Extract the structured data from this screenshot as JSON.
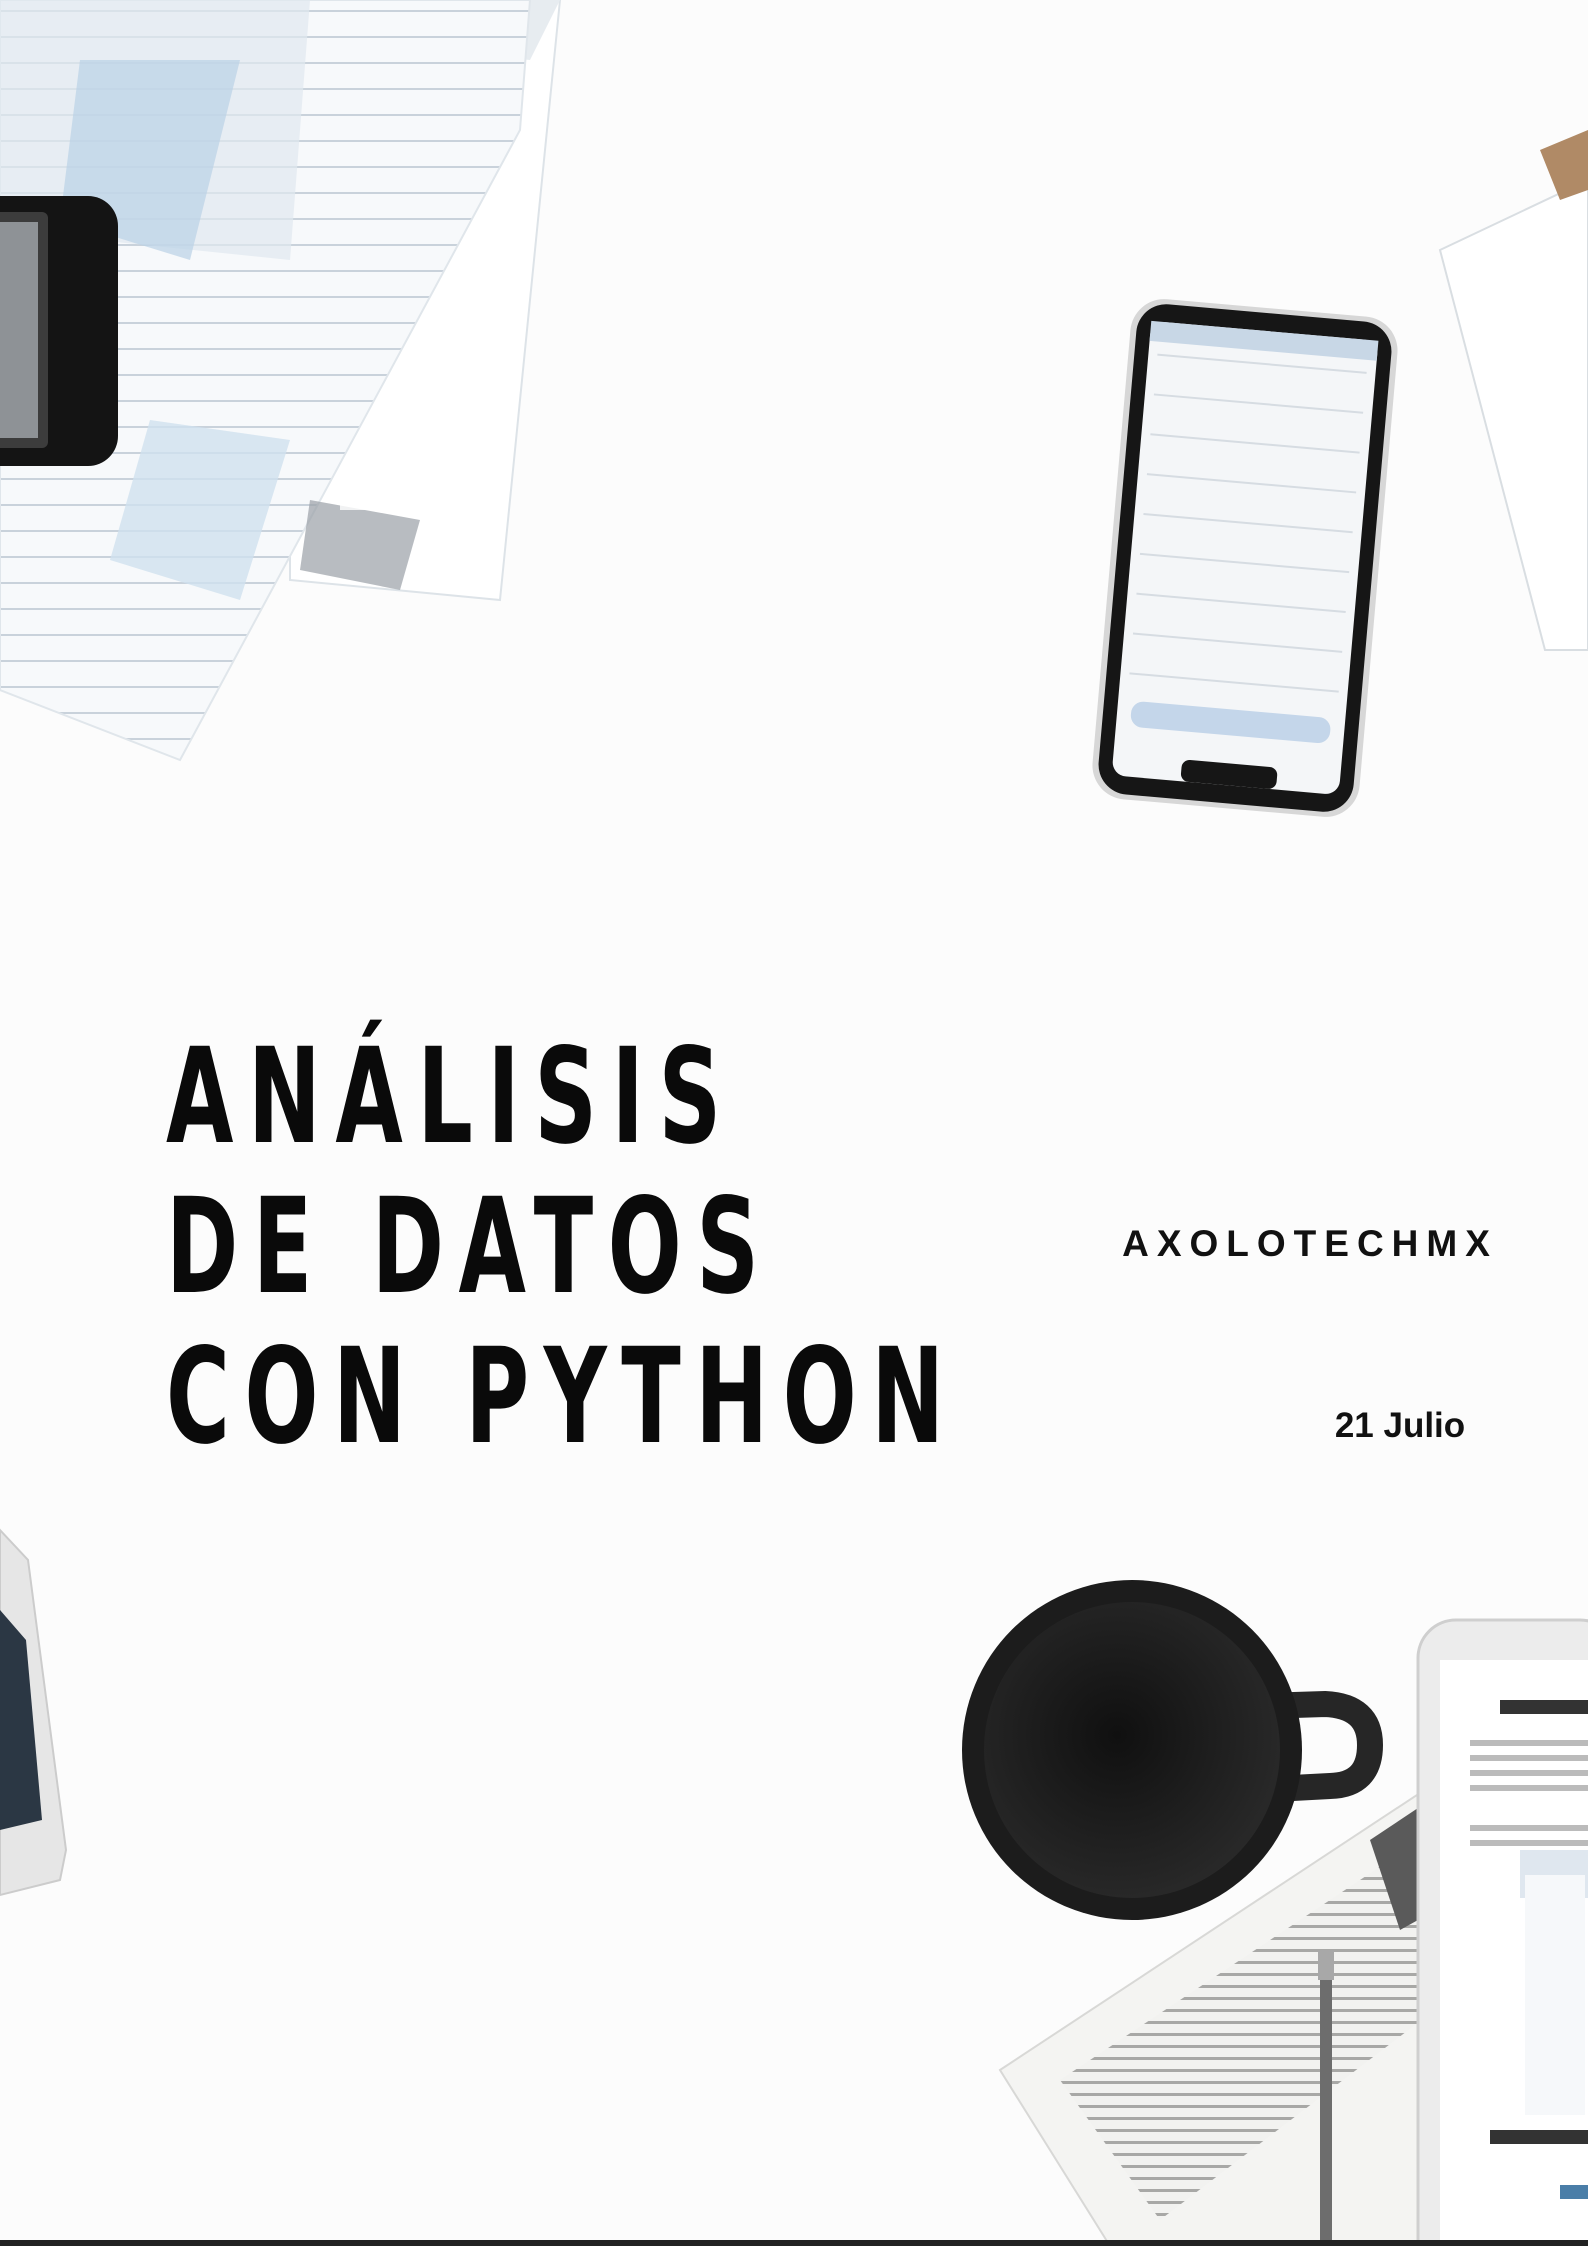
{
  "cover": {
    "title_lines": [
      "ANÁLISIS",
      "DE DATOS",
      "CON PYTHON"
    ],
    "author": "AXOLOTECHMX",
    "date": "21 Julio"
  }
}
